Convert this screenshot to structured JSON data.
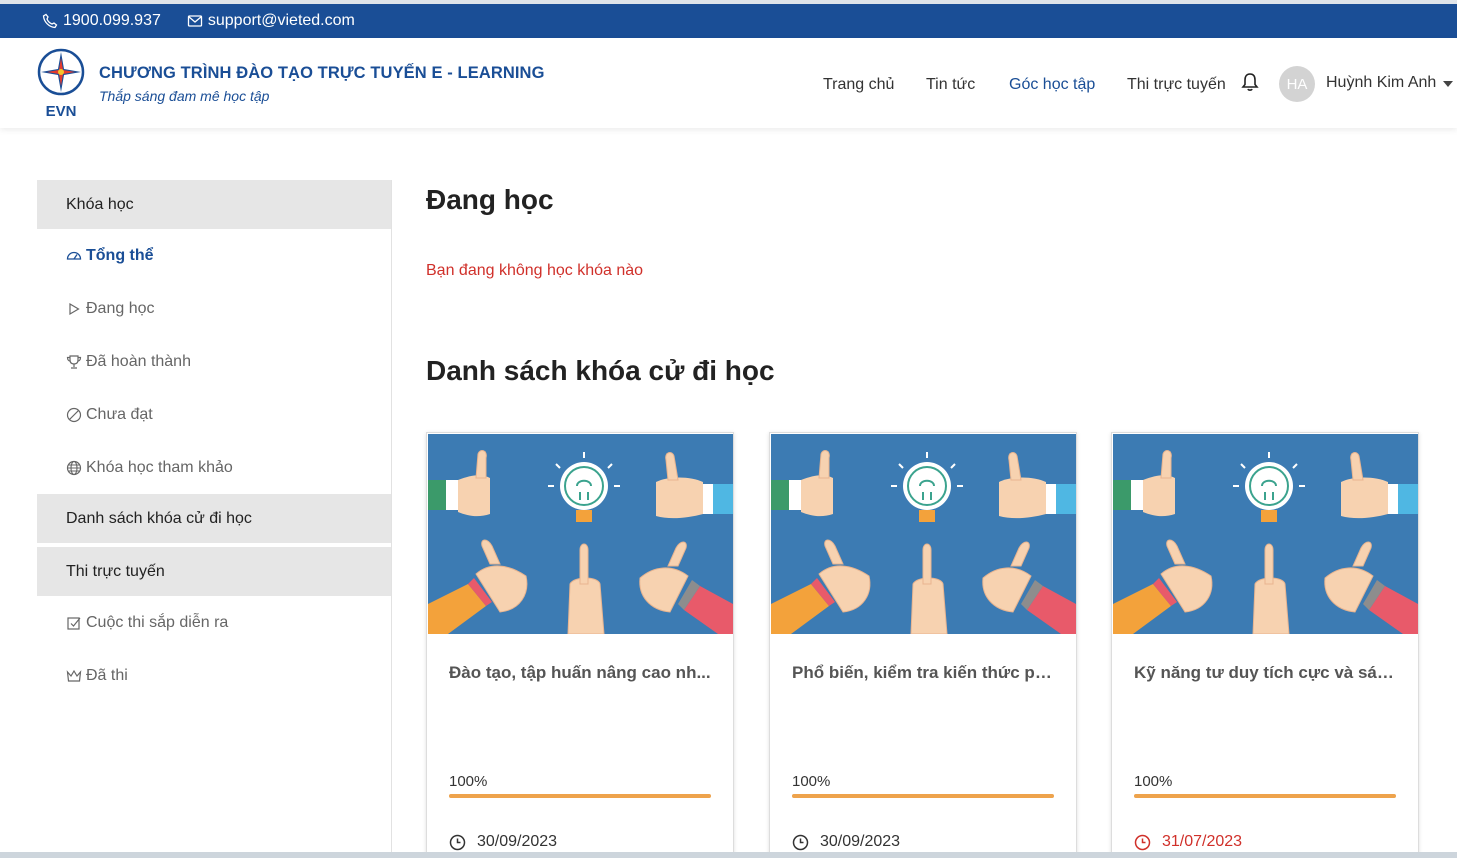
{
  "topbar": {
    "phone": "1900.099.937",
    "email": "support@vieted.com"
  },
  "brand": {
    "logo_text": "EVN",
    "title": "CHƯƠNG TRÌNH ĐÀO TẠO TRỰC TUYẾN E - LEARNING",
    "slogan": "Thắp sáng đam mê học tập"
  },
  "nav": {
    "items": [
      "Trang chủ",
      "Tin tức",
      "Góc học tập",
      "Thi trực tuyến"
    ],
    "active": "Góc học tập"
  },
  "user": {
    "initials": "HA",
    "name": "Huỳnh Kim Anh"
  },
  "sidebar": {
    "sections": [
      {
        "title": "Khóa học",
        "items": [
          {
            "label": "Tổng thể",
            "icon": "dashboard-icon",
            "active": true
          },
          {
            "label": "Đang học",
            "icon": "play-icon"
          },
          {
            "label": "Đã hoàn thành",
            "icon": "trophy-icon"
          },
          {
            "label": "Chưa đạt",
            "icon": "ban-icon"
          },
          {
            "label": "Khóa học tham khảo",
            "icon": "globe-icon"
          }
        ]
      },
      {
        "title": "Danh sách khóa cử đi học",
        "items": []
      },
      {
        "title": "Thi trực tuyến",
        "items": [
          {
            "label": "Cuộc thi sắp diễn ra",
            "icon": "checkbox-icon"
          },
          {
            "label": "Đã thi",
            "icon": "crown-icon"
          }
        ]
      }
    ]
  },
  "main": {
    "learning_title": "Đang học",
    "learning_empty": "Bạn đang không học khóa nào",
    "assigned_title": "Danh sách khóa cử đi học",
    "courses": [
      {
        "title": "Đào tạo, tập huấn nâng cao nh...",
        "progress_label": "100%",
        "progress": 1.0,
        "date": "30/09/2023",
        "overdue": false
      },
      {
        "title": "Phổ biến, kiểm tra kiến thức ph...",
        "progress_label": "100%",
        "progress": 1.0,
        "date": "30/09/2023",
        "overdue": false
      },
      {
        "title": "Kỹ năng tư duy tích cực và sán...",
        "progress_label": "100%",
        "progress": 1.0,
        "date": "31/07/2023",
        "overdue": true
      }
    ]
  },
  "colors": {
    "primary": "#1a4e96",
    "accent": "#eea34c",
    "danger": "#d0302a",
    "thumb_bg": "#3c7bb3"
  }
}
